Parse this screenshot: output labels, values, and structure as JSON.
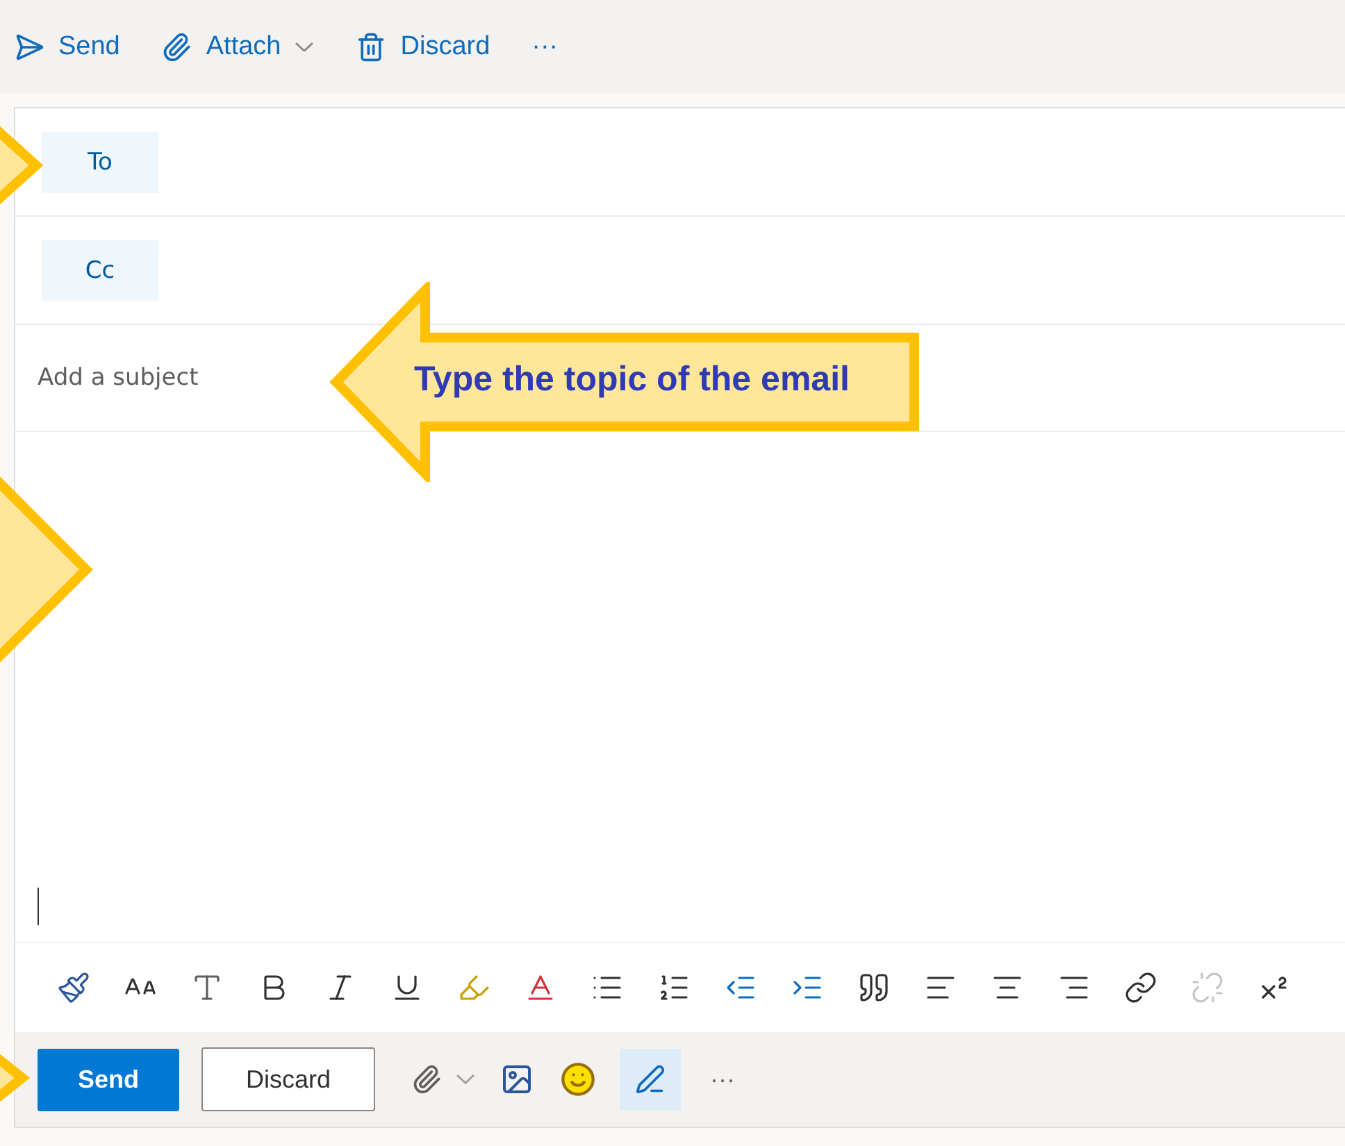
{
  "top_toolbar": [
    {
      "kind": "send",
      "label": "Send"
    },
    {
      "kind": "attach",
      "label": "Attach"
    },
    {
      "kind": "discard",
      "label": "Discard"
    },
    {
      "kind": "more",
      "label": "···"
    }
  ],
  "recipients": [
    {
      "label": "To"
    },
    {
      "label": "Cc"
    }
  ],
  "subject": {
    "placeholder": "Add a subject"
  },
  "callout": {
    "text": "Type the topic of the email"
  },
  "bottom_bar": {
    "send": "Send",
    "discard": "Discard",
    "more": "···",
    "format_toggle_selected": true
  }
}
